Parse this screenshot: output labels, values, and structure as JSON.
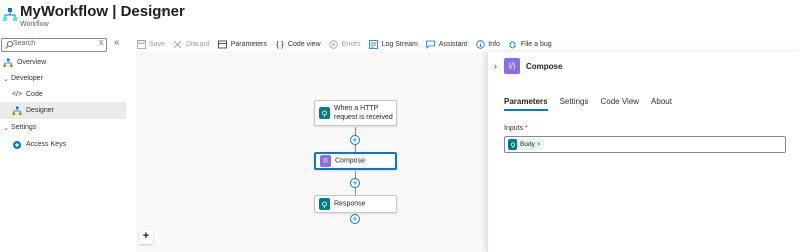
{
  "header": {
    "title": "MyWorkflow | Designer",
    "subtitle": "Workflow",
    "more_label": "···"
  },
  "nav": {
    "search_placeholder": "Search",
    "search_clear": "X",
    "collapse_label": "«",
    "items": [
      {
        "label": "Overview",
        "icon": "logic-app-icon"
      },
      {
        "label": "Developer",
        "icon": "chevron-down-icon",
        "group": true
      },
      {
        "label": "Code",
        "icon": "code-icon"
      },
      {
        "label": "Designer",
        "icon": "designer-icon",
        "active": true
      },
      {
        "label": "Settings",
        "icon": "chevron-down-icon",
        "group": true
      },
      {
        "label": "Access Keys",
        "icon": "key-icon"
      }
    ]
  },
  "toolbar": {
    "save": "Save",
    "discard": "Discard",
    "parameters": "Parameters",
    "code_view": "Code view",
    "errors": "Errors",
    "log_stream": "Log Stream",
    "assistant": "Assistant",
    "info": "Info",
    "file_bug": "File a bug"
  },
  "canvas": {
    "nodes": [
      {
        "label": "When a HTTP request is received",
        "color": "#007c89",
        "icon": "http-request-icon"
      },
      {
        "label": "Compose",
        "color": "#8c6cde",
        "icon": "compose-icon",
        "selected": true
      },
      {
        "label": "Response",
        "color": "#007c89",
        "icon": "response-icon"
      }
    ],
    "zoom_in": "+"
  },
  "panel": {
    "title": "Compose",
    "expand": "›",
    "tabs": [
      {
        "label": "Parameters",
        "active": true
      },
      {
        "label": "Settings"
      },
      {
        "label": "Code View"
      },
      {
        "label": "About"
      }
    ],
    "inputs_label": "Inputs",
    "required_mark": "*",
    "token_label": "Body",
    "token_remove": "×"
  },
  "colors": {
    "accent": "#0078d4",
    "http": "#007c89",
    "compose": "#8c6cde"
  }
}
